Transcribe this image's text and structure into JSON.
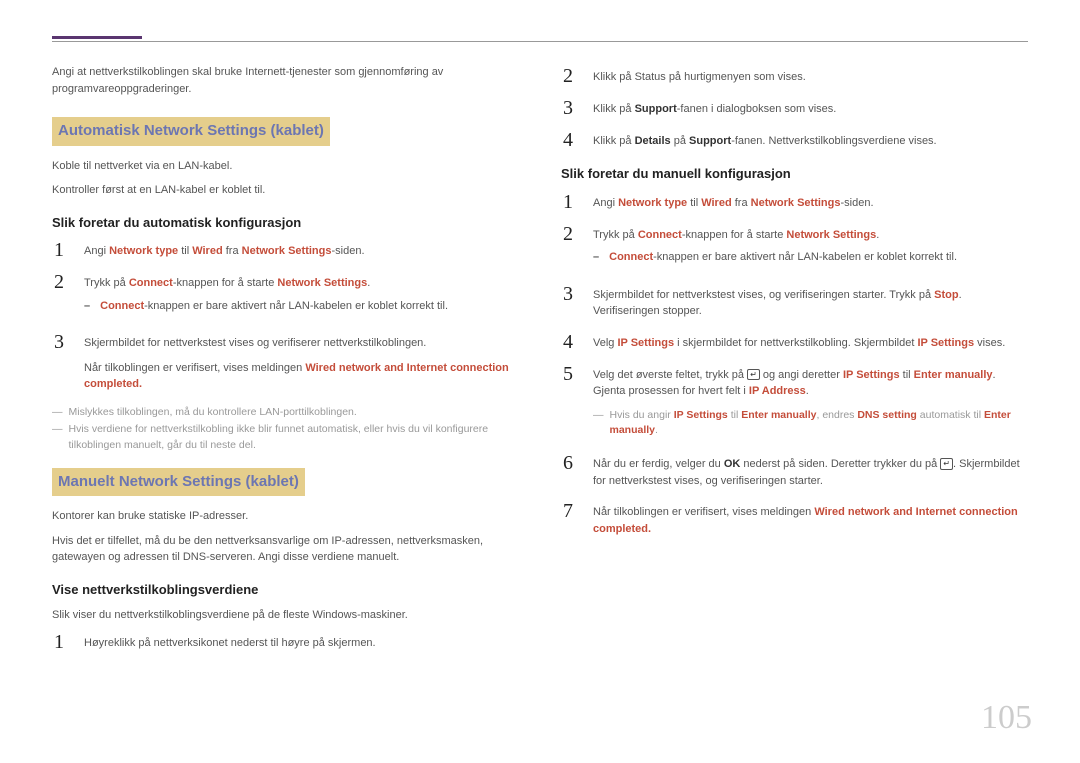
{
  "page_number": "105",
  "left": {
    "intro": "Angi at nettverkstilkoblingen skal bruke Internett-tjenester som gjennomføring av programvareoppgraderinger.",
    "heading_auto": "Automatisk Network Settings (kablet)",
    "auto_p1": "Koble til nettverket via en LAN-kabel.",
    "auto_p2": "Kontroller først at en LAN-kabel er koblet til.",
    "subheading_auto": "Slik foretar du automatisk konfigurasjon",
    "steps_auto": {
      "s1_pre": "Angi ",
      "s1_a": "Network type",
      "s1_mid": " til ",
      "s1_b": "Wired",
      "s1_mid2": " fra ",
      "s1_c": "Network Settings",
      "s1_post": "-siden.",
      "s2_pre": "Trykk på ",
      "s2_a": "Connect",
      "s2_mid": "-knappen for å starte ",
      "s2_b": "Network Settings",
      "s2_post": ".",
      "s2_sub_pre": "",
      "s2_sub_a": "Connect",
      "s2_sub_post": "-knappen er bare aktivert når LAN-kabelen er koblet korrekt til.",
      "s3": "Skjermbildet for nettverkstest vises og verifiserer nettverkstilkoblingen.",
      "s3_p2_pre": "Når tilkoblingen er verifisert, vises meldingen ",
      "s3_p2_a": "Wired network and Internet connection completed."
    },
    "note1": "Mislykkes tilkoblingen, må du kontrollere LAN-porttilkoblingen.",
    "note2": "Hvis verdiene for nettverkstilkobling ikke blir funnet automatisk, eller hvis du vil konfigurere tilkoblingen manuelt, går du til neste del.",
    "heading_manual": "Manuelt Network Settings (kablet)",
    "manual_p1": "Kontorer kan bruke statiske IP-adresser.",
    "manual_p2": "Hvis det er tilfellet, må du be den nettverksansvarlige om IP-adressen, nettverksmasken, gatewayen og adressen til DNS-serveren. Angi disse verdiene manuelt.",
    "subheading_view": "Vise nettverkstilkoblingsverdiene",
    "view_intro": "Slik viser du nettverkstilkoblingsverdiene på de fleste Windows-maskiner.",
    "view_s1": "Høyreklikk på nettverksikonet nederst til høyre på skjermen."
  },
  "right": {
    "view_s2": "Klikk på Status på hurtigmenyen som vises.",
    "view_s3_pre": "Klikk på ",
    "view_s3_a": "Support",
    "view_s3_post": "-fanen i dialogboksen som vises.",
    "view_s4_pre": "Klikk på ",
    "view_s4_a": "Details",
    "view_s4_mid": " på ",
    "view_s4_b": "Support",
    "view_s4_post": "-fanen. Nettverkstilkoblingsverdiene vises.",
    "subheading_manual_conf": "Slik foretar du manuell konfigurasjon",
    "man": {
      "s1_pre": "Angi ",
      "s1_a": "Network type",
      "s1_mid": " til ",
      "s1_b": "Wired",
      "s1_mid2": " fra ",
      "s1_c": "Network Settings",
      "s1_post": "-siden.",
      "s2_pre": "Trykk på ",
      "s2_a": "Connect",
      "s2_mid": "-knappen for å starte ",
      "s2_b": "Network Settings",
      "s2_post": ".",
      "s2_sub_a": "Connect",
      "s2_sub_post": "-knappen er bare aktivert når LAN-kabelen er koblet korrekt til.",
      "s3_pre": "Skjermbildet for nettverkstest vises, og verifiseringen starter. Trykk på ",
      "s3_a": "Stop",
      "s3_post": ". Verifiseringen stopper.",
      "s4_pre": "Velg ",
      "s4_a": "IP Settings",
      "s4_mid": " i skjermbildet for nettverkstilkobling. Skjermbildet ",
      "s4_b": "IP Settings",
      "s4_post": " vises.",
      "s5_pre": "Velg det øverste feltet, trykk på ",
      "s5_icon": "↵",
      "s5_mid": " og angi deretter ",
      "s5_a": "IP Settings",
      "s5_mid2": " til ",
      "s5_b": "Enter manually",
      "s5_mid3": ". Gjenta prosessen for hvert felt i ",
      "s5_c": "IP Address",
      "s5_post": ".",
      "s5_note_pre": "Hvis du angir ",
      "s5_note_a": "IP Settings",
      "s5_note_mid": " til ",
      "s5_note_b": "Enter manually",
      "s5_note_mid2": ", endres ",
      "s5_note_c": "DNS setting",
      "s5_note_mid3": " automatisk til ",
      "s5_note_d": "Enter manually",
      "s5_note_post": ".",
      "s6_pre": "Når du er ferdig, velger du ",
      "s6_a": "OK",
      "s6_mid": " nederst på siden. Deretter trykker du på ",
      "s6_icon": "↵",
      "s6_post": ". Skjermbildet for nettverkstest vises, og verifiseringen starter.",
      "s7_pre": "Når tilkoblingen er verifisert, vises meldingen ",
      "s7_a": "Wired network and Internet connection completed."
    }
  }
}
